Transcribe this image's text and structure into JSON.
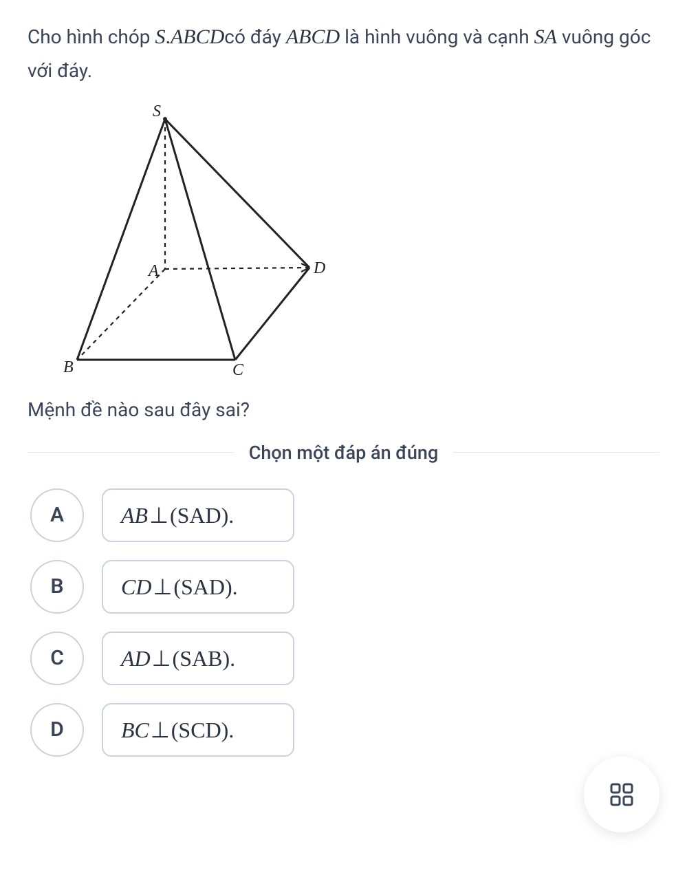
{
  "question": {
    "part1": "Cho hình chóp ",
    "math1_prefix": "S",
    "math1_dot": ".",
    "math1_rest": "ABCD",
    "part2": "có đáy ",
    "math2": "ABCD",
    "part3": " là hình vuông và cạnh ",
    "math3": "SA",
    "part4": " vuông góc với đáy."
  },
  "diagram": {
    "labels": {
      "S": "S",
      "A": "A",
      "B": "B",
      "C": "C",
      "D": "D"
    }
  },
  "subquestion": "Mệnh đề nào sau đây sai?",
  "instruction": "Chọn một đáp án đúng",
  "options": [
    {
      "letter": "A",
      "lhs": "AB",
      "perp": "⊥",
      "rhs": "(SAD)",
      "dot": "."
    },
    {
      "letter": "B",
      "lhs": "CD",
      "perp": "⊥",
      "rhs": "(SAD)",
      "dot": "."
    },
    {
      "letter": "C",
      "lhs": "AD",
      "perp": "⊥",
      "rhs": "(SAB)",
      "dot": "."
    },
    {
      "letter": "D",
      "lhs": "BC",
      "perp": "⊥",
      "rhs": "(SCD)",
      "dot": "."
    }
  ],
  "fab_icon": "grid-icon"
}
